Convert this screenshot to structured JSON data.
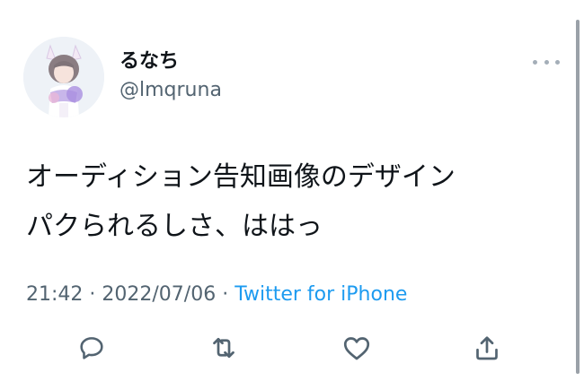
{
  "user": {
    "display_name": "るなち",
    "handle": "@lmqruna"
  },
  "tweet": {
    "text": "オーディション告知画像のデザイン\nパクられるしさ、ははっ",
    "time": "21:42",
    "separator_1": " · ",
    "date": "2022/07/06",
    "separator_2": " · ",
    "source": "Twitter for iPhone"
  },
  "icons": {
    "more": "more-horizontal-icon",
    "reply": "reply-icon",
    "retweet": "retweet-icon",
    "like": "like-icon",
    "share": "share-icon"
  },
  "colors": {
    "text": "#0f1419",
    "secondary": "#536471",
    "link": "#1d9bf0",
    "icon": "#536471"
  }
}
